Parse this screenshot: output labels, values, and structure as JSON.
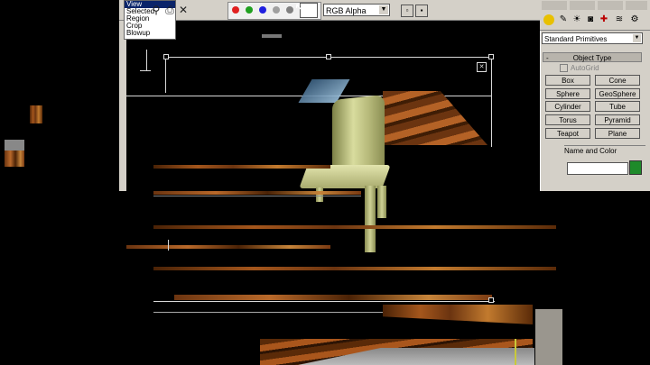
{
  "render_window": {
    "area_menu": [
      "View",
      "Selected",
      "Region",
      "Crop",
      "Blowup"
    ],
    "area_menu_selected": 0,
    "channel_select": "RGB Alpha",
    "channel_buttons": [
      {
        "name": "red",
        "color": "#e02020"
      },
      {
        "name": "green",
        "color": "#20a020"
      },
      {
        "name": "blue",
        "color": "#2020e0"
      },
      {
        "name": "mono",
        "color": "#a0a0a0"
      }
    ]
  },
  "command_panel": {
    "category_select": "Standard Primitives",
    "rollout_object_type": "Object Type",
    "autogrid_label": "AutoGrid",
    "primitives": [
      "Box",
      "Cone",
      "Sphere",
      "GeoSphere",
      "Cylinder",
      "Tube",
      "Torus",
      "Pyramid",
      "Teapot",
      "Plane"
    ],
    "rollout_name_color": "Name and Color",
    "object_color": "#1e8a2a"
  }
}
